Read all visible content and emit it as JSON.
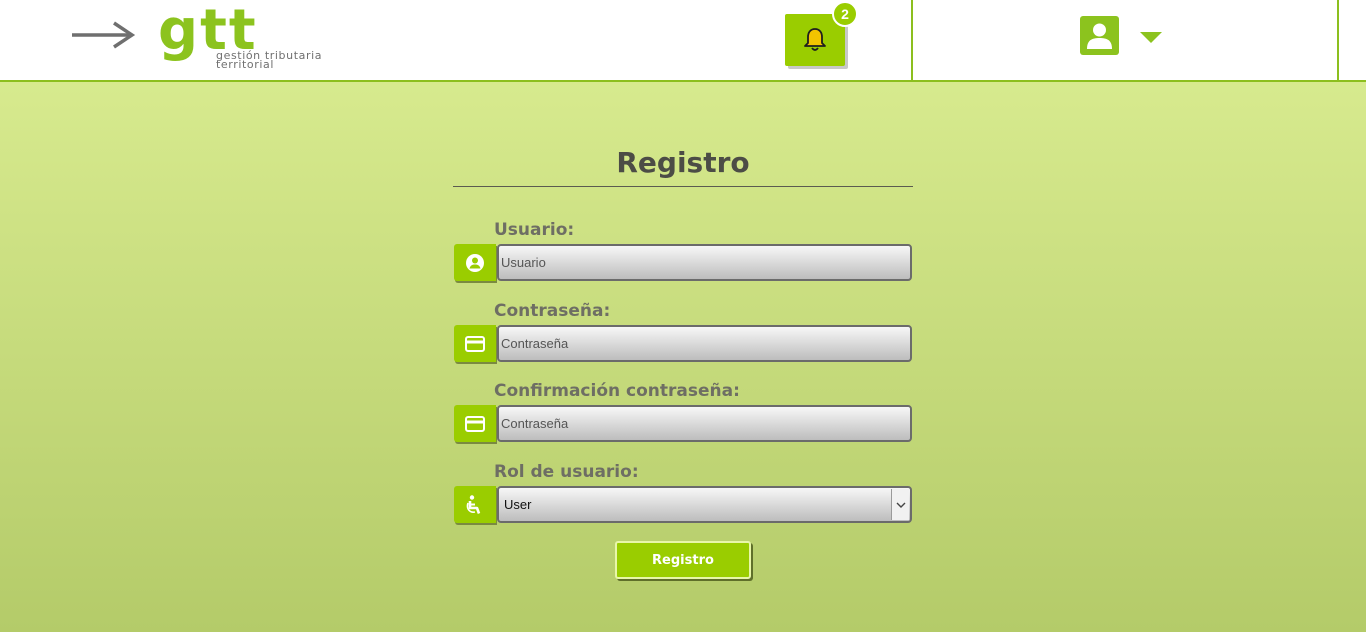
{
  "header": {
    "logo_text": "gtt",
    "logo_subtitle_line1": "gestión tributaria",
    "logo_subtitle_line2": "territorial",
    "notifications_count": "2",
    "icons": {
      "back": "arrow-right-icon",
      "notifications": "bell-icon",
      "user": "user-icon",
      "menu": "caret-down-icon"
    }
  },
  "form": {
    "title": "Registro",
    "fields": [
      {
        "label": "Usuario:",
        "placeholder": "Usuario",
        "icon": "user-circle-icon"
      },
      {
        "label": "Contraseña:",
        "placeholder": "Contraseña",
        "icon": "card-icon"
      },
      {
        "label": "Confirmación contraseña:",
        "placeholder": "Contraseña",
        "icon": "card-icon"
      }
    ],
    "role": {
      "label": "Rol de usuario:",
      "selected": "User",
      "icon": "accessible-icon"
    },
    "submit_label": "Registro"
  },
  "colors": {
    "accent": "#9acd00",
    "logo": "#8cc31e",
    "background_top": "#d7ea8e",
    "background_bottom": "#b4cb69",
    "text_dark": "#4c4c46",
    "label": "#6e6e64"
  }
}
